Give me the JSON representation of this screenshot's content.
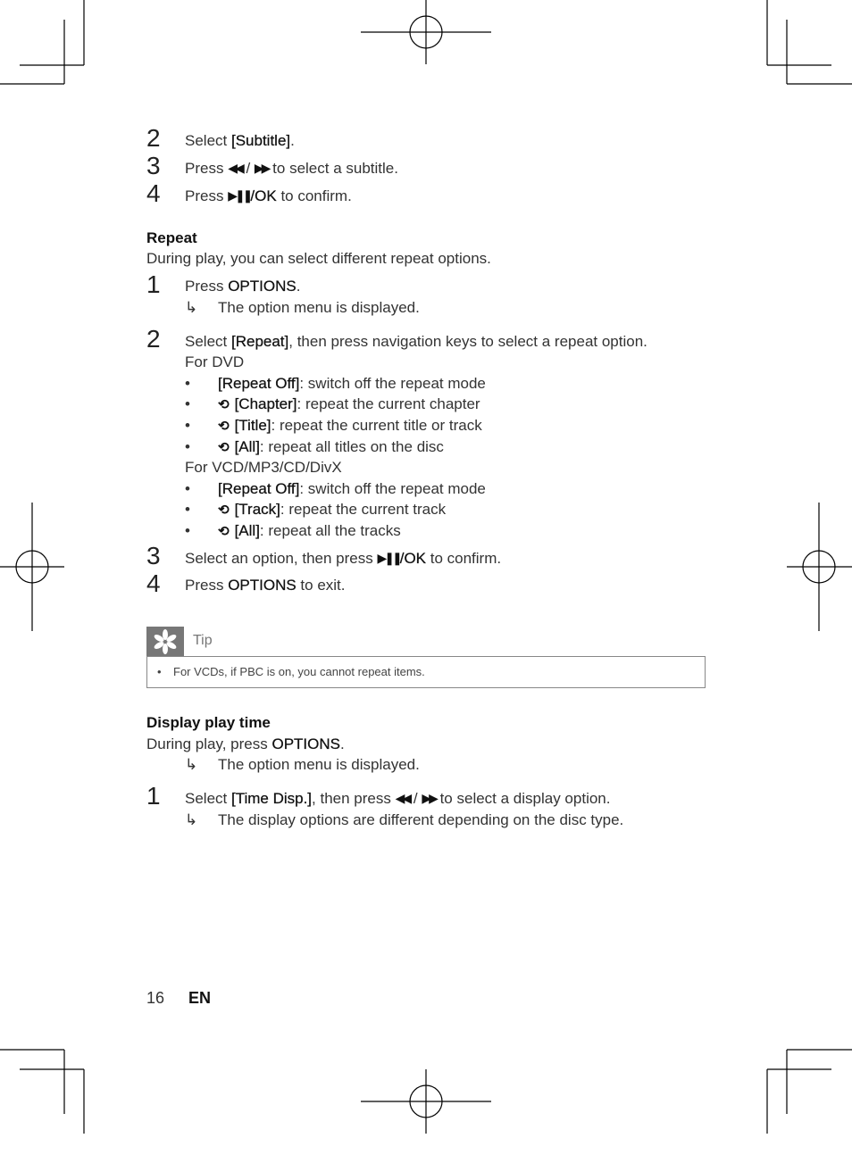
{
  "page": {
    "number": "16",
    "lang": "EN"
  },
  "icons": {
    "rew": "◀◀",
    "ffw": "▶▶",
    "playpause": "▶❚❚",
    "repeat": "⟲",
    "arrow": "↳",
    "bullet": "•"
  },
  "subtitle_steps": [
    {
      "num": "2",
      "pre": "Select ",
      "bold": "[Subtitle]",
      "post": "."
    },
    {
      "num": "3",
      "pre": "Press ",
      "mid": " / ",
      "post": " to select a subtitle."
    },
    {
      "num": "4",
      "pre": "Press ",
      "ok": "/OK",
      "post": " to confirm."
    }
  ],
  "repeat": {
    "heading": "Repeat",
    "intro": "During play, you can select different repeat options.",
    "step1": {
      "num": "1",
      "pre": "Press ",
      "bold": "OPTIONS",
      "post": ".",
      "result": "The option menu is displayed."
    },
    "step2": {
      "num": "2",
      "pre": "Select ",
      "bold": "[Repeat]",
      "post": ", then press navigation keys to select a repeat option."
    },
    "dvd_label": "For DVD",
    "dvd_items": [
      {
        "bold": "[Repeat Off]",
        "text": ": switch off the repeat mode",
        "icon": false
      },
      {
        "bold": "[Chapter]",
        "text": ": repeat the current chapter",
        "icon": true
      },
      {
        "bold": "[Title]",
        "text": ": repeat the current title or track",
        "icon": true
      },
      {
        "bold": "[All]",
        "text": ": repeat all titles on the disc",
        "icon": true
      }
    ],
    "vcd_label": "For VCD/MP3/CD/DivX",
    "vcd_items": [
      {
        "bold": "[Repeat Off]",
        "text": ": switch off the repeat mode",
        "icon": false
      },
      {
        "bold": "[Track]",
        "text": ": repeat the current track",
        "icon": true
      },
      {
        "bold": "[All]",
        "text": ": repeat all the tracks",
        "icon": true
      }
    ],
    "step3": {
      "num": "3",
      "pre": "Select an option, then press ",
      "ok": "/OK",
      "post": " to confirm."
    },
    "step4": {
      "num": "4",
      "pre": "Press ",
      "bold": "OPTIONS",
      "post": " to exit."
    }
  },
  "tip": {
    "label": "Tip",
    "text": "For VCDs, if PBC is on, you cannot repeat items."
  },
  "display_time": {
    "heading": "Display play time",
    "intro_pre": "During play, press ",
    "intro_bold": "OPTIONS",
    "intro_post": ".",
    "intro_result": "The option menu is displayed.",
    "step1": {
      "num": "1",
      "pre": "Select ",
      "bold": "[Time Disp.]",
      "mid1": ", then press ",
      "mid2": " / ",
      "post": " to select a display option.",
      "result": "The display options are different depending on the disc type."
    }
  }
}
